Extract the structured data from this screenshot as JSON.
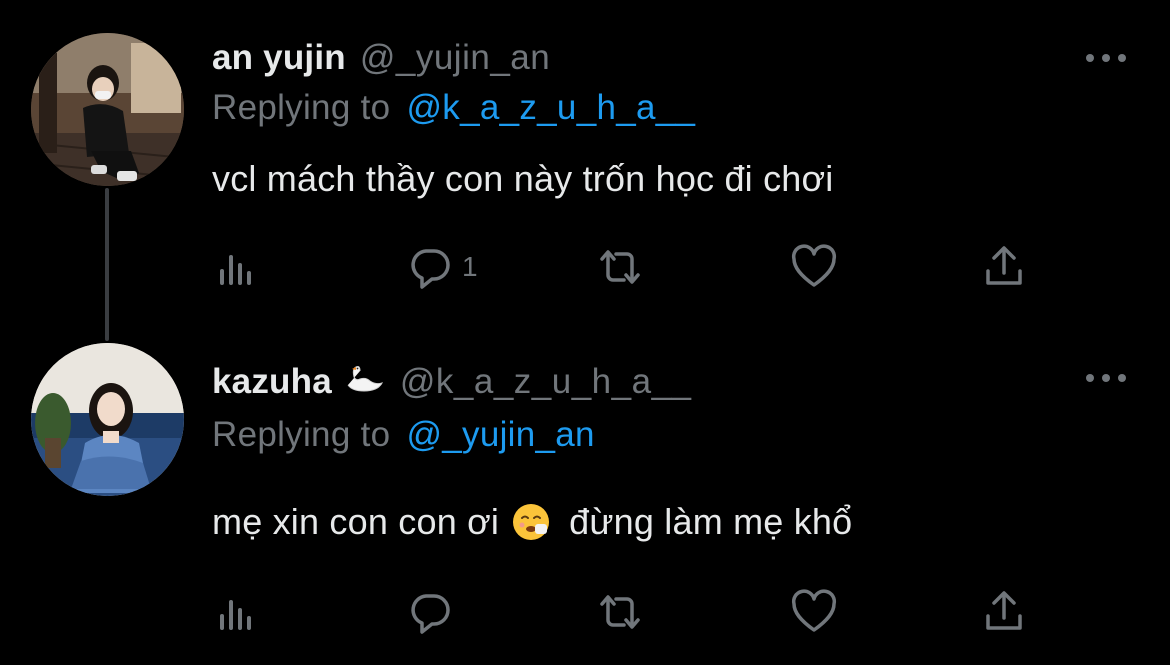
{
  "tweets": [
    {
      "display_name": "an yujin",
      "handle": "@_yujin_an",
      "replying_prefix": "Replying to",
      "replying_to": "@k_a_z_u_h_a__",
      "text": "vcl mách thầy con này trốn học đi chơi",
      "reply_count": "1",
      "icons": {
        "analytics": "analytics-icon",
        "reply": "reply-icon",
        "retweet": "retweet-icon",
        "like": "heart-icon",
        "share": "share-icon",
        "more": "more-icon"
      }
    },
    {
      "display_name": "kazuha",
      "name_emoji": "swan-emoji",
      "handle": "@k_a_z_u_h_a__",
      "replying_prefix": "Replying to",
      "replying_to": "@_yujin_an",
      "text_before_emoji": "mẹ xin con con ơi",
      "text_emoji": "sneezing-face-emoji",
      "text_after_emoji": "đừng làm mẹ khổ",
      "reply_count": "",
      "icons": {
        "analytics": "analytics-icon",
        "reply": "reply-icon",
        "retweet": "retweet-icon",
        "like": "heart-icon",
        "share": "share-icon",
        "more": "more-icon"
      }
    }
  ],
  "colors": {
    "background": "#000000",
    "text_primary": "#e7e9ea",
    "text_secondary": "#71767b",
    "accent": "#1d9bf0",
    "thread_line": "#3a3d41"
  }
}
